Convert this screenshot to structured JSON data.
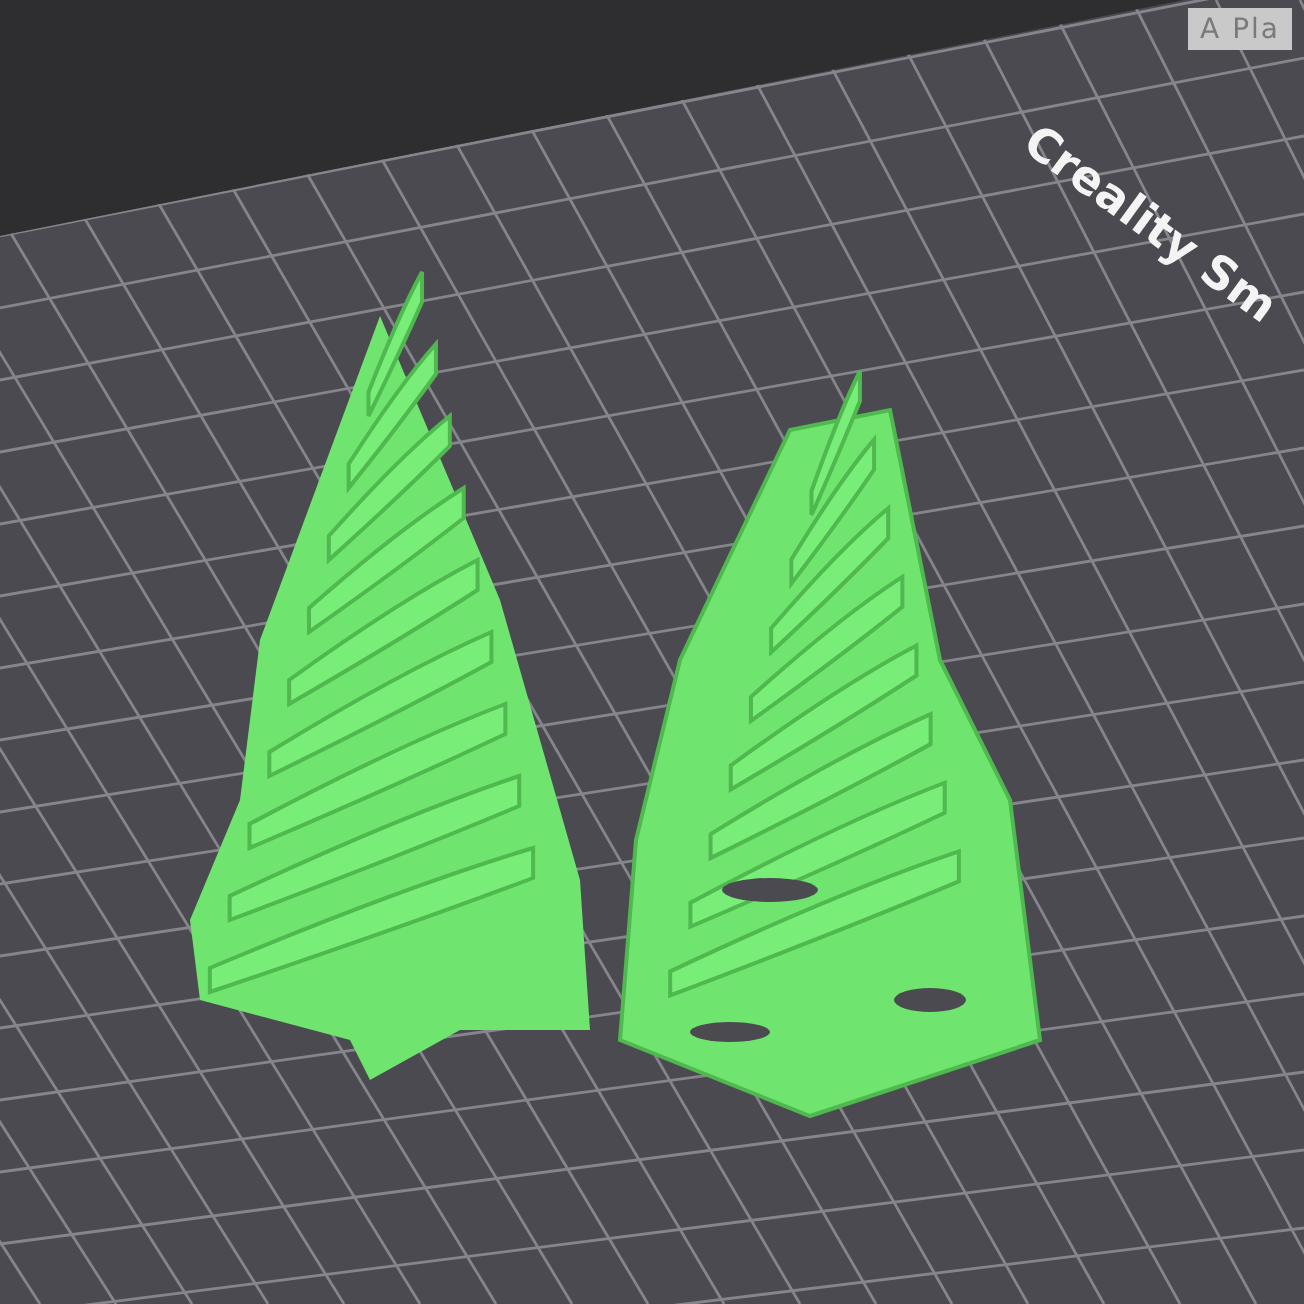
{
  "viewport": {
    "bed_label": "Creality Sm",
    "plate_tab": "A Pla"
  }
}
